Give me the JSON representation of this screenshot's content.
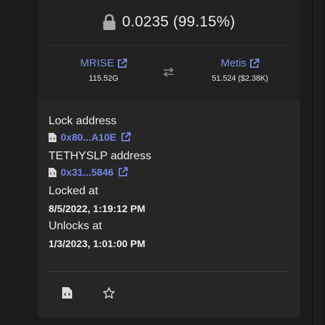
{
  "lock": {
    "amount_text": "0.0235 (99.15%)",
    "icon": "lock-icon"
  },
  "pair": {
    "token0": {
      "symbol": "MRISE",
      "amount": "115.52G",
      "icon": "external-link-icon"
    },
    "token1": {
      "symbol": "Metis",
      "amount": "51.524 ($2.38K)",
      "icon": "external-link-icon"
    },
    "swap_icon": "swap-arrows-icon"
  },
  "details": {
    "lock_address_label": "Lock address",
    "lock_address_value": "0x80...A10E",
    "lp_address_label": "TETHYSLP address",
    "lp_address_value": "0x31...5846",
    "locked_at_label": "Locked at",
    "locked_at_value": "8/5/2022, 1:19:12 PM",
    "unlocks_at_label": "Unlocks at",
    "unlocks_at_value": "1/3/2023, 1:01:00 PM"
  },
  "actions": {
    "code_icon": "file-code-icon",
    "star_icon": "star-icon"
  },
  "colors": {
    "link": "#7584e6",
    "token_link": "#7e8fd8",
    "card_bg": "#262626",
    "page_bg": "#1b1b1b"
  }
}
